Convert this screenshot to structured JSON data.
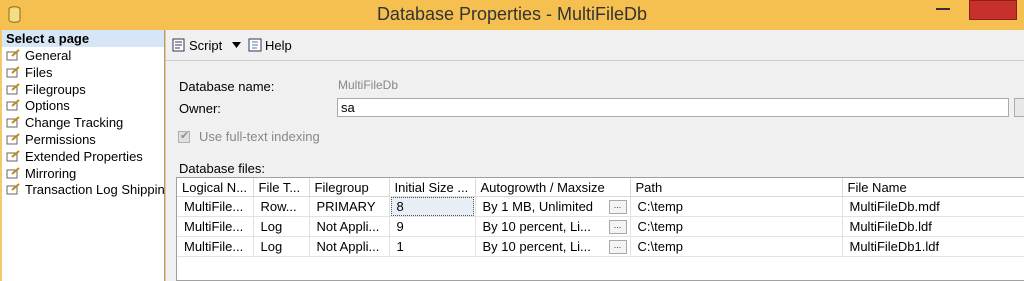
{
  "window": {
    "title": "Database Properties - MultiFileDb"
  },
  "sidebar": {
    "header": "Select a page",
    "items": [
      {
        "label": "General"
      },
      {
        "label": "Files"
      },
      {
        "label": "Filegroups"
      },
      {
        "label": "Options"
      },
      {
        "label": "Change Tracking"
      },
      {
        "label": "Permissions"
      },
      {
        "label": "Extended Properties"
      },
      {
        "label": "Mirroring"
      },
      {
        "label": "Transaction Log Shipping"
      }
    ]
  },
  "toolbar": {
    "script_label": "Script",
    "help_label": "Help"
  },
  "form": {
    "database_name_label": "Database name:",
    "database_name_value": "MultiFileDb",
    "owner_label": "Owner:",
    "owner_value": "sa",
    "fulltext_label": "Use full-text indexing",
    "database_files_label": "Database files:"
  },
  "files_table": {
    "headers": [
      "Logical N...",
      "File T...",
      "Filegroup",
      "Initial Size ...",
      "Autogrowth / Maxsize",
      "Path",
      "File Name"
    ],
    "rows": [
      [
        "MultiFile...",
        "Row...",
        "PRIMARY",
        "8",
        "By 1 MB, Unlimited",
        "C:\\temp",
        "MultiFileDb.mdf"
      ],
      [
        "MultiFile...",
        "Log",
        "Not Appli...",
        "9",
        "By 10 percent, Li...",
        "C:\\temp",
        "MultiFileDb.ldf"
      ],
      [
        "MultiFile...",
        "Log",
        "Not Appli...",
        "1",
        "By 10 percent, Li...",
        "C:\\temp",
        "MultiFileDb1.ldf"
      ]
    ],
    "ellipsis_label": "..."
  }
}
